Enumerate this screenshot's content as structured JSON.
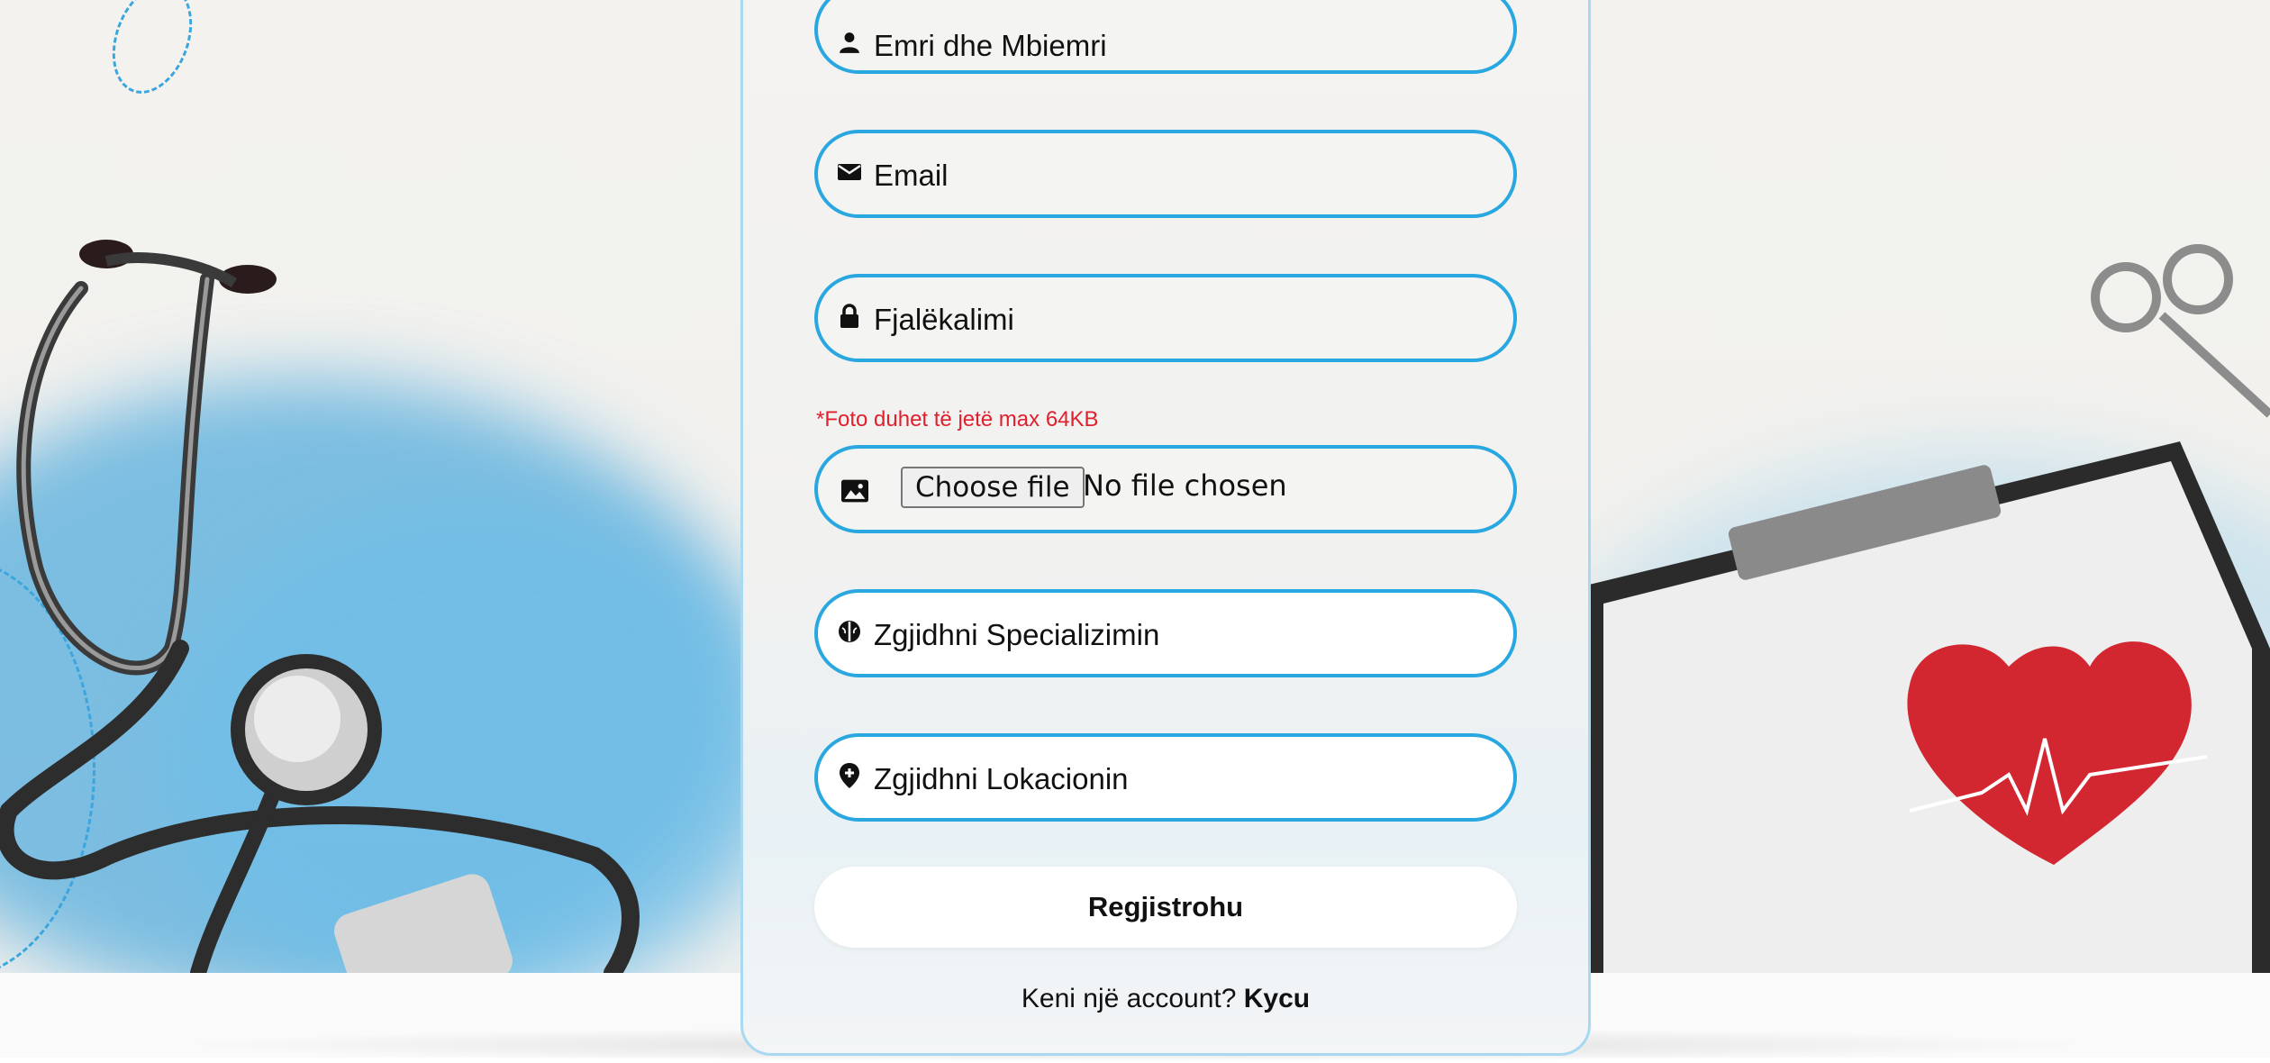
{
  "form": {
    "fields": {
      "name": {
        "placeholder": "Emri dhe Mbiemri",
        "icon": "person-icon"
      },
      "email": {
        "placeholder": "Email",
        "icon": "envelope-icon"
      },
      "password": {
        "placeholder": "Fjalëkalimi",
        "icon": "lock-icon"
      },
      "photo": {
        "hint": "*Foto duhet të jetë max 64KB",
        "button": "Choose file",
        "status": "No file chosen",
        "icon": "image-icon"
      },
      "specialization": {
        "placeholder": "Zgjidhni Specializimin",
        "icon": "brain-icon"
      },
      "location": {
        "placeholder": "Zgjidhni Lokacionin",
        "icon": "location-pin-icon"
      }
    },
    "submit_label": "Regjistrohu",
    "footer": {
      "question": "Keni një account?",
      "link": "Kycu"
    }
  },
  "colors": {
    "field_border": "#29a7e0",
    "hint": "#e0202e",
    "card_border": "#a9d8f1"
  }
}
